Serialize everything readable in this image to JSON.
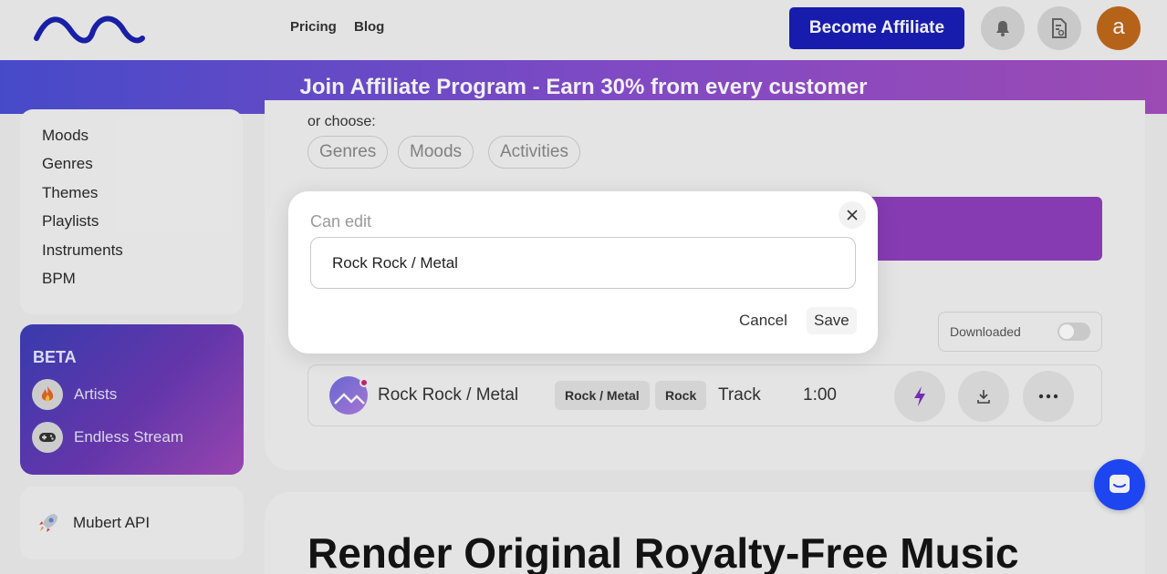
{
  "header": {
    "nav": [
      "Pricing",
      "Blog"
    ],
    "affiliate_button": "Become Affiliate",
    "avatar_letter": "a"
  },
  "promo_banner": "Join Affiliate Program - Earn 30% from every customer",
  "sidebar": {
    "items": [
      "Moods",
      "Genres",
      "Themes",
      "Playlists",
      "Instruments",
      "BPM"
    ],
    "beta": {
      "title": "BETA",
      "items": [
        "Artists",
        "Endless Stream"
      ]
    },
    "api_item": "Mubert API"
  },
  "main": {
    "or_choose": "or choose:",
    "pills": [
      "Genres",
      "Moods",
      "Activities"
    ],
    "downloaded_label": "Downloaded",
    "track": {
      "title": "Rock Rock / Metal",
      "tags": [
        "Rock / Metal",
        "Rock"
      ],
      "type": "Track",
      "duration": "1:00"
    },
    "render_heading": "Render Original Royalty-Free Music"
  },
  "modal": {
    "label": "Can edit",
    "input_value": "Rock Rock / Metal",
    "cancel": "Cancel",
    "save": "Save"
  },
  "colors": {
    "affiliate_button": "#1a1eb8",
    "promo_start": "#4b4fd6",
    "promo_end": "#a64fbf",
    "avatar": "#c26a1c",
    "chat_button": "#1f4bff"
  }
}
